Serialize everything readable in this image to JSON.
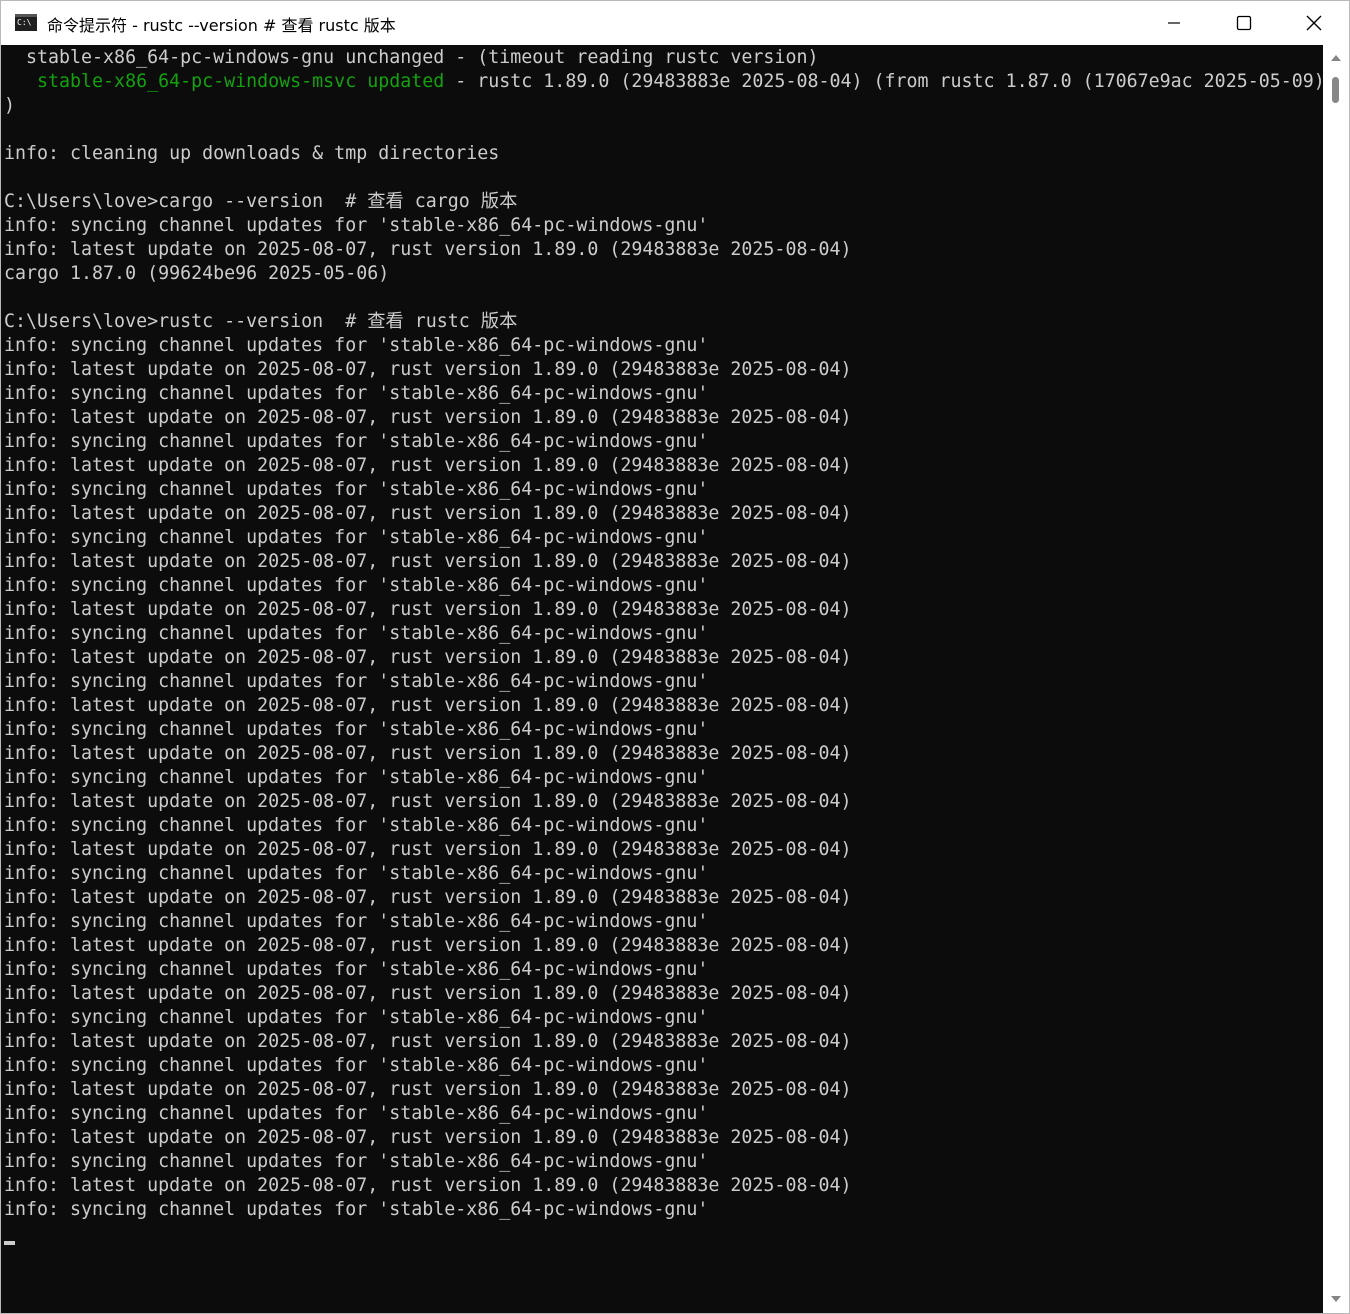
{
  "window": {
    "title": "命令提示符 - rustc  --version # 查看 rustc 版本",
    "icon_label": "C:\\",
    "controls": {
      "minimize_icon": "minimize-icon",
      "maximize_icon": "maximize-icon",
      "close_icon": "close-icon"
    }
  },
  "colors": {
    "background": "#0c0c0c",
    "text": "#cccccc",
    "green": "#13a10e"
  },
  "terminal": {
    "lines": [
      {
        "text": "  stable-x86_64-pc-windows-gnu unchanged - (timeout reading rustc version)"
      },
      {
        "segments": [
          {
            "text": "   stable-x86_64-pc-windows-msvc updated",
            "color": "green"
          },
          {
            "text": " - rustc 1.89.0 (29483883e 2025-08-04) (from rustc 1.87.0 (17067e9ac 2025-05-09)"
          }
        ]
      },
      {
        "text": ")"
      },
      {
        "text": ""
      },
      {
        "text": "info: cleaning up downloads & tmp directories"
      },
      {
        "text": ""
      },
      {
        "text": "C:\\Users\\love>cargo --version  # 查看 cargo 版本"
      },
      {
        "text": "info: syncing channel updates for 'stable-x86_64-pc-windows-gnu'"
      },
      {
        "text": "info: latest update on 2025-08-07, rust version 1.89.0 (29483883e 2025-08-04)"
      },
      {
        "text": "cargo 1.87.0 (99624be96 2025-05-06)"
      },
      {
        "text": ""
      },
      {
        "text": "C:\\Users\\love>rustc --version  # 查看 rustc 版本"
      },
      {
        "text": "info: syncing channel updates for 'stable-x86_64-pc-windows-gnu'"
      },
      {
        "text": "info: latest update on 2025-08-07, rust version 1.89.0 (29483883e 2025-08-04)"
      },
      {
        "text": "info: syncing channel updates for 'stable-x86_64-pc-windows-gnu'"
      },
      {
        "text": "info: latest update on 2025-08-07, rust version 1.89.0 (29483883e 2025-08-04)"
      },
      {
        "text": "info: syncing channel updates for 'stable-x86_64-pc-windows-gnu'"
      },
      {
        "text": "info: latest update on 2025-08-07, rust version 1.89.0 (29483883e 2025-08-04)"
      },
      {
        "text": "info: syncing channel updates for 'stable-x86_64-pc-windows-gnu'"
      },
      {
        "text": "info: latest update on 2025-08-07, rust version 1.89.0 (29483883e 2025-08-04)"
      },
      {
        "text": "info: syncing channel updates for 'stable-x86_64-pc-windows-gnu'"
      },
      {
        "text": "info: latest update on 2025-08-07, rust version 1.89.0 (29483883e 2025-08-04)"
      },
      {
        "text": "info: syncing channel updates for 'stable-x86_64-pc-windows-gnu'"
      },
      {
        "text": "info: latest update on 2025-08-07, rust version 1.89.0 (29483883e 2025-08-04)"
      },
      {
        "text": "info: syncing channel updates for 'stable-x86_64-pc-windows-gnu'"
      },
      {
        "text": "info: latest update on 2025-08-07, rust version 1.89.0 (29483883e 2025-08-04)"
      },
      {
        "text": "info: syncing channel updates for 'stable-x86_64-pc-windows-gnu'"
      },
      {
        "text": "info: latest update on 2025-08-07, rust version 1.89.0 (29483883e 2025-08-04)"
      },
      {
        "text": "info: syncing channel updates for 'stable-x86_64-pc-windows-gnu'"
      },
      {
        "text": "info: latest update on 2025-08-07, rust version 1.89.0 (29483883e 2025-08-04)"
      },
      {
        "text": "info: syncing channel updates for 'stable-x86_64-pc-windows-gnu'"
      },
      {
        "text": "info: latest update on 2025-08-07, rust version 1.89.0 (29483883e 2025-08-04)"
      },
      {
        "text": "info: syncing channel updates for 'stable-x86_64-pc-windows-gnu'"
      },
      {
        "text": "info: latest update on 2025-08-07, rust version 1.89.0 (29483883e 2025-08-04)"
      },
      {
        "text": "info: syncing channel updates for 'stable-x86_64-pc-windows-gnu'"
      },
      {
        "text": "info: latest update on 2025-08-07, rust version 1.89.0 (29483883e 2025-08-04)"
      },
      {
        "text": "info: syncing channel updates for 'stable-x86_64-pc-windows-gnu'"
      },
      {
        "text": "info: latest update on 2025-08-07, rust version 1.89.0 (29483883e 2025-08-04)"
      },
      {
        "text": "info: syncing channel updates for 'stable-x86_64-pc-windows-gnu'"
      },
      {
        "text": "info: latest update on 2025-08-07, rust version 1.89.0 (29483883e 2025-08-04)"
      },
      {
        "text": "info: syncing channel updates for 'stable-x86_64-pc-windows-gnu'"
      },
      {
        "text": "info: latest update on 2025-08-07, rust version 1.89.0 (29483883e 2025-08-04)"
      },
      {
        "text": "info: syncing channel updates for 'stable-x86_64-pc-windows-gnu'"
      },
      {
        "text": "info: latest update on 2025-08-07, rust version 1.89.0 (29483883e 2025-08-04)"
      },
      {
        "text": "info: syncing channel updates for 'stable-x86_64-pc-windows-gnu'"
      },
      {
        "text": "info: latest update on 2025-08-07, rust version 1.89.0 (29483883e 2025-08-04)"
      },
      {
        "text": "info: syncing channel updates for 'stable-x86_64-pc-windows-gnu'"
      },
      {
        "text": "info: latest update on 2025-08-07, rust version 1.89.0 (29483883e 2025-08-04)"
      },
      {
        "text": "info: syncing channel updates for 'stable-x86_64-pc-windows-gnu'"
      }
    ]
  }
}
